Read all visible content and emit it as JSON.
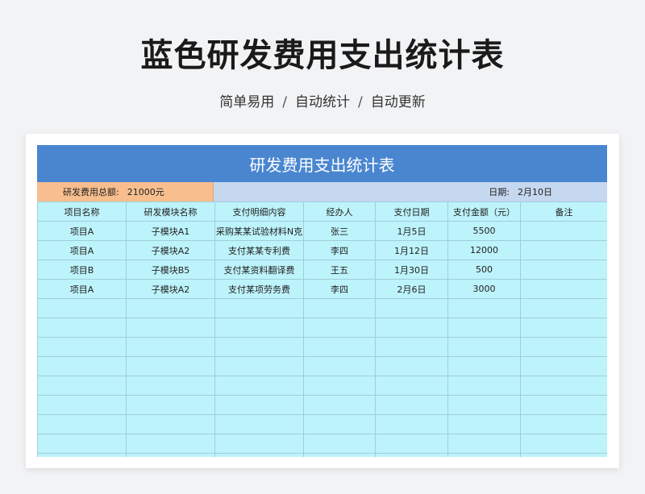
{
  "page": {
    "title": "蓝色研发费用支出统计表",
    "subtitle_parts": [
      "简单易用",
      "自动统计",
      "自动更新"
    ],
    "separator": "/"
  },
  "sheet": {
    "title": "研发费用支出统计表",
    "total_label": "研发费用总额:",
    "total_value": "21000元",
    "date_label": "日期:",
    "date_value": "2月10日",
    "columns": [
      "项目名称",
      "研发模块名称",
      "支付明细内容",
      "经办人",
      "支付日期",
      "支付金额（元）",
      "备注"
    ],
    "rows": [
      [
        "项目A",
        "子模块A1",
        "采购某某试验材料N克",
        "张三",
        "1月5日",
        "5500",
        ""
      ],
      [
        "项目A",
        "子模块A2",
        "支付某某专利费",
        "李四",
        "1月12日",
        "12000",
        ""
      ],
      [
        "项目B",
        "子模块B5",
        "支付某资料翻译费",
        "王五",
        "1月30日",
        "500",
        ""
      ],
      [
        "项目A",
        "子模块A2",
        "支付某项劳务费",
        "李四",
        "2月6日",
        "3000",
        ""
      ]
    ],
    "empty_rows": 9
  },
  "colors": {
    "header_bg": "#4a86d0",
    "total_bg": "#f8be8e",
    "date_bg": "#c6d7f0",
    "table_bg": "#bdf3fb",
    "grid": "#9fcfda"
  }
}
